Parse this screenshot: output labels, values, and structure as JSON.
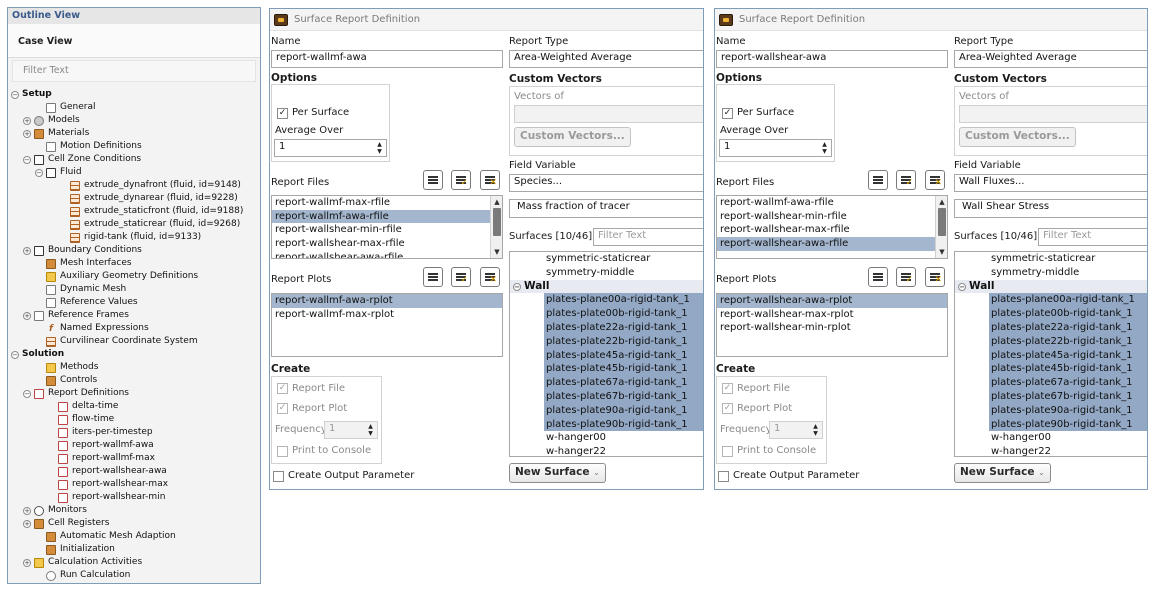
{
  "outline": {
    "title": "Outline View",
    "case_view": "Case View",
    "filter_placeholder": "Filter Text",
    "items": [
      {
        "label": "Setup",
        "bold": true,
        "tog": "−",
        "indent": 0,
        "icon": "none",
        "name": "setup"
      },
      {
        "label": "General",
        "tog": "",
        "indent": 2,
        "icon": "doc",
        "name": "general"
      },
      {
        "label": "Models",
        "tog": "+",
        "indent": 1,
        "icon": "gear",
        "name": "models"
      },
      {
        "label": "Materials",
        "tog": "+",
        "indent": 1,
        "icon": "mat",
        "name": "materials"
      },
      {
        "label": "Motion Definitions",
        "tog": "",
        "indent": 2,
        "icon": "doc",
        "name": "motion-definitions"
      },
      {
        "label": "Cell Zone Conditions",
        "tog": "−",
        "indent": 1,
        "icon": "box",
        "name": "cell-zone-conditions"
      },
      {
        "label": "Fluid",
        "tog": "−",
        "indent": 2,
        "icon": "box",
        "name": "fluid"
      },
      {
        "label": "extrude_dynafront (fluid, id=9148)",
        "tog": "",
        "indent": 4,
        "icon": "grid",
        "name": "extrude-dynafront"
      },
      {
        "label": "extrude_dynarear (fluid, id=9228)",
        "tog": "",
        "indent": 4,
        "icon": "grid",
        "name": "extrude-dynarear"
      },
      {
        "label": "extrude_staticfront (fluid, id=9188)",
        "tog": "",
        "indent": 4,
        "icon": "grid",
        "name": "extrude-staticfront"
      },
      {
        "label": "extrude_staticrear (fluid, id=9268)",
        "tog": "",
        "indent": 4,
        "icon": "grid",
        "name": "extrude-staticrear"
      },
      {
        "label": "rigid-tank (fluid, id=9133)",
        "tog": "",
        "indent": 4,
        "icon": "grid",
        "name": "rigid-tank"
      },
      {
        "label": "Boundary Conditions",
        "tog": "+",
        "indent": 1,
        "icon": "box",
        "name": "boundary-conditions"
      },
      {
        "label": "Mesh Interfaces",
        "tog": "",
        "indent": 2,
        "icon": "mat",
        "name": "mesh-interfaces"
      },
      {
        "label": "Auxiliary Geometry Definitions",
        "tog": "",
        "indent": 2,
        "icon": "yel",
        "name": "auxiliary-geometry"
      },
      {
        "label": "Dynamic Mesh",
        "tog": "",
        "indent": 2,
        "icon": "doc",
        "name": "dynamic-mesh"
      },
      {
        "label": "Reference Values",
        "tog": "",
        "indent": 2,
        "icon": "doc",
        "name": "reference-values"
      },
      {
        "label": "Reference Frames",
        "tog": "+",
        "indent": 1,
        "icon": "doc",
        "name": "reference-frames"
      },
      {
        "label": "Named Expressions",
        "tog": "",
        "indent": 2,
        "icon": "fx",
        "name": "named-expressions"
      },
      {
        "label": "Curvilinear Coordinate System",
        "tog": "",
        "indent": 2,
        "icon": "grid",
        "name": "curvilinear-coordinate-system"
      },
      {
        "label": "Solution",
        "bold": true,
        "tog": "−",
        "indent": 0,
        "icon": "none",
        "name": "solution"
      },
      {
        "label": "Methods",
        "tog": "",
        "indent": 2,
        "icon": "yel",
        "name": "methods"
      },
      {
        "label": "Controls",
        "tog": "",
        "indent": 2,
        "icon": "mat",
        "name": "controls"
      },
      {
        "label": "Report Definitions",
        "tog": "−",
        "indent": 1,
        "icon": "rep",
        "name": "report-definitions"
      },
      {
        "label": "delta-time",
        "tog": "",
        "indent": 3,
        "icon": "rep",
        "name": "delta-time"
      },
      {
        "label": "flow-time",
        "tog": "",
        "indent": 3,
        "icon": "rep",
        "name": "flow-time"
      },
      {
        "label": "iters-per-timestep",
        "tog": "",
        "indent": 3,
        "icon": "rep",
        "name": "iters-per-timestep"
      },
      {
        "label": "report-wallmf-awa",
        "tog": "",
        "indent": 3,
        "icon": "rep",
        "name": "report-wallmf-awa"
      },
      {
        "label": "report-wallmf-max",
        "tog": "",
        "indent": 3,
        "icon": "rep",
        "name": "report-wallmf-max"
      },
      {
        "label": "report-wallshear-awa",
        "tog": "",
        "indent": 3,
        "icon": "rep",
        "name": "report-wallshear-awa"
      },
      {
        "label": "report-wallshear-max",
        "tog": "",
        "indent": 3,
        "icon": "rep",
        "name": "report-wallshear-max"
      },
      {
        "label": "report-wallshear-min",
        "tog": "",
        "indent": 3,
        "icon": "rep",
        "name": "report-wallshear-min"
      },
      {
        "label": "Monitors",
        "tog": "+",
        "indent": 1,
        "icon": "mon",
        "name": "monitors"
      },
      {
        "label": "Cell Registers",
        "tog": "+",
        "indent": 1,
        "icon": "mat",
        "name": "cell-registers"
      },
      {
        "label": "Automatic Mesh Adaption",
        "tog": "",
        "indent": 2,
        "icon": "mat",
        "name": "automatic-mesh-adaption"
      },
      {
        "label": "Initialization",
        "tog": "",
        "indent": 2,
        "icon": "mat",
        "name": "initialization"
      },
      {
        "label": "Calculation Activities",
        "tog": "+",
        "indent": 1,
        "icon": "yel",
        "name": "calculation-activities"
      },
      {
        "label": "Run Calculation",
        "tog": "",
        "indent": 2,
        "icon": "circ",
        "name": "run-calculation"
      }
    ]
  },
  "panels": [
    {
      "title": "Surface Report Definition",
      "name_label": "Name",
      "name_value": "report-wallmf-awa",
      "options_label": "Options",
      "per_surface_label": "Per Surface",
      "per_surface_checked": "✓",
      "average_over_label": "Average Over",
      "average_over_value": "1",
      "report_files_label": "Report Files",
      "report_files": [
        "report-wallmf-max-rfile",
        "report-wallmf-awa-rfile",
        "report-wallshear-min-rfile",
        "report-wallshear-max-rfile",
        "report-wallshear-awa-rfile"
      ],
      "report_files_selected": 1,
      "report_plots_label": "Report Plots",
      "report_plots": [
        "report-wallmf-awa-rplot",
        "report-wallmf-max-rplot"
      ],
      "report_plots_selected": 0,
      "create_label": "Create",
      "report_file_label": "Report File",
      "report_plot_label": "Report Plot",
      "frequency_label": "Frequency",
      "frequency_value": "1",
      "print_console_label": "Print to Console",
      "create_output_label": "Create Output Parameter",
      "report_type_label": "Report Type",
      "report_type_value": "Area-Weighted Average",
      "custom_vectors_label": "Custom Vectors",
      "vectors_of_label": "Vectors of",
      "custom_vectors_button": "Custom Vectors...",
      "field_variable_label": "Field Variable",
      "field_variable_value": "Species...",
      "field_sub_value": "Mass fraction of tracer",
      "surfaces_label": "Surfaces [10/46]",
      "surfaces_filter_placeholder": "Filter Text",
      "surfaces_top": [
        "symmetric-staticrear",
        "symmetry-middle"
      ],
      "wall_group": "Wall",
      "wall_items": [
        "plates-plane00a-rigid-tank_1",
        "plates-plate00b-rigid-tank_1",
        "plates-plate22a-rigid-tank_1",
        "plates-plate22b-rigid-tank_1",
        "plates-plate45a-rigid-tank_1",
        "plates-plate45b-rigid-tank_1",
        "plates-plate67a-rigid-tank_1",
        "plates-plate67b-rigid-tank_1",
        "plates-plate90a-rigid-tank_1",
        "plates-plate90b-rigid-tank_1"
      ],
      "surfaces_bottom": [
        "w-hanger00",
        "w-hanger22"
      ],
      "new_surface_button": "New Surface"
    },
    {
      "title": "Surface Report Definition",
      "name_label": "Name",
      "name_value": "report-wallshear-awa",
      "options_label": "Options",
      "per_surface_label": "Per Surface",
      "per_surface_checked": "✓",
      "average_over_label": "Average Over",
      "average_over_value": "1",
      "report_files_label": "Report Files",
      "report_files": [
        "report-wallmf-awa-rfile",
        "report-wallshear-min-rfile",
        "report-wallshear-max-rfile",
        "report-wallshear-awa-rfile"
      ],
      "report_files_selected": 3,
      "report_plots_label": "Report Plots",
      "report_plots": [
        "report-wallshear-awa-rplot",
        "report-wallshear-max-rplot",
        "report-wallshear-min-rplot"
      ],
      "report_plots_selected": 0,
      "create_label": "Create",
      "report_file_label": "Report File",
      "report_plot_label": "Report Plot",
      "frequency_label": "Frequency",
      "frequency_value": "1",
      "print_console_label": "Print to Console",
      "create_output_label": "Create Output Parameter",
      "report_type_label": "Report Type",
      "report_type_value": "Area-Weighted Average",
      "custom_vectors_label": "Custom Vectors",
      "vectors_of_label": "Vectors of",
      "custom_vectors_button": "Custom Vectors...",
      "field_variable_label": "Field Variable",
      "field_variable_value": "Wall Fluxes...",
      "field_sub_value": "Wall Shear Stress",
      "surfaces_label": "Surfaces [10/46]",
      "surfaces_filter_placeholder": "Filter Text",
      "surfaces_top": [
        "symmetric-staticrear",
        "symmetry-middle"
      ],
      "wall_group": "Wall",
      "wall_items": [
        "plates-plane00a-rigid-tank_1",
        "plates-plate00b-rigid-tank_1",
        "plates-plate22a-rigid-tank_1",
        "plates-plate22b-rigid-tank_1",
        "plates-plate45a-rigid-tank_1",
        "plates-plate45b-rigid-tank_1",
        "plates-plate67a-rigid-tank_1",
        "plates-plate67b-rigid-tank_1",
        "plates-plate90a-rigid-tank_1",
        "plates-plate90b-rigid-tank_1"
      ],
      "surfaces_bottom": [
        "w-hanger00",
        "w-hanger22"
      ],
      "new_surface_button": "New Surface"
    }
  ],
  "colors": {
    "selection": "#a3b6cd",
    "border": "#7f9db9",
    "accent_title": "#3a5a8a"
  }
}
